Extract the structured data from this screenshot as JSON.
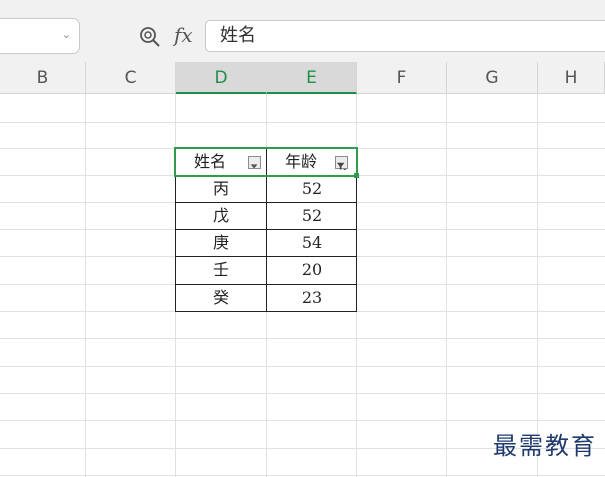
{
  "formula_bar": {
    "formula_label": "fx",
    "content": "姓名"
  },
  "columns": [
    "B",
    "C",
    "D",
    "E",
    "F",
    "G",
    "H"
  ],
  "selected_columns": [
    "D",
    "E"
  ],
  "table": {
    "headers": [
      "姓名",
      "年龄"
    ],
    "rows": [
      [
        "丙",
        "52"
      ],
      [
        "戊",
        "52"
      ],
      [
        "庚",
        "54"
      ],
      [
        "壬",
        "20"
      ],
      [
        "癸",
        "23"
      ]
    ],
    "filter_active_column": "年龄"
  },
  "watermark": "最需教育",
  "colors": {
    "selection": "#2e9b4f",
    "grid": "#e1e1e1",
    "header_bg": "#f1f1f1"
  }
}
